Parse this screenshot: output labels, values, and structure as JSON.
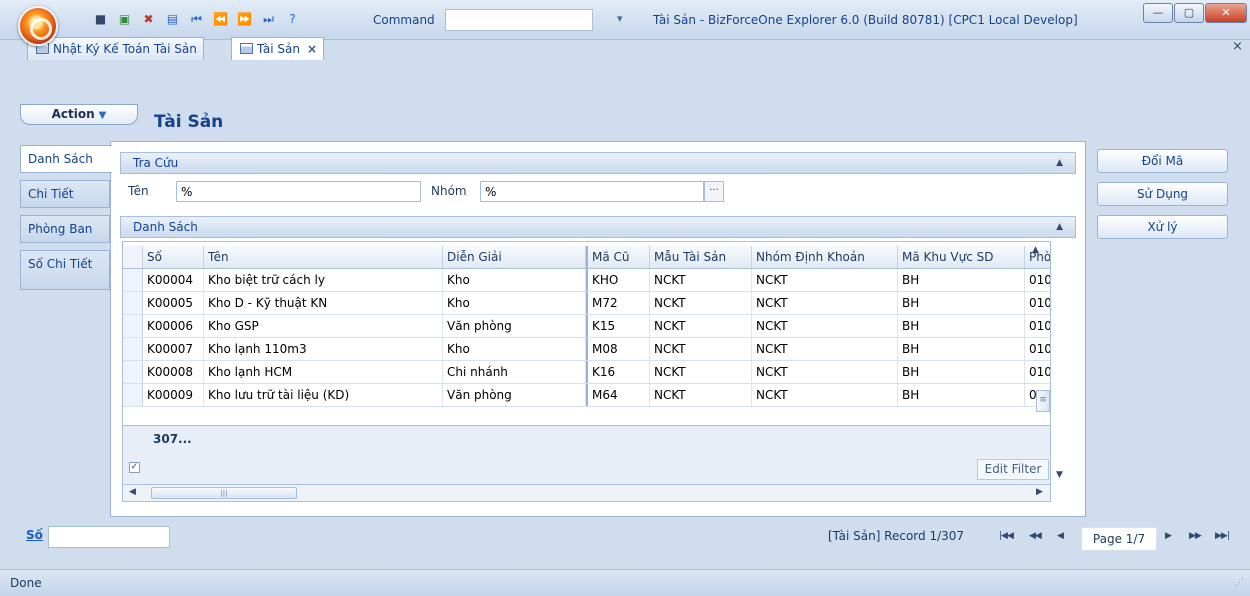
{
  "titlebar": {
    "command_label": "Command",
    "command_value": "",
    "window_title": "Tài Sản - BizForceOne Explorer 6.0 (Build 80781) [CPC1 Local Develop]",
    "qat_more_icon": "dropdown-arrow-icon"
  },
  "tabs": [
    {
      "label": "Nhật Ký Kế Toán Tài Sản"
    },
    {
      "label": "Tài Sản",
      "close": "×"
    }
  ],
  "doc_close_all": "×",
  "toolbar": {
    "action_label": "Action"
  },
  "page_title": "Tài Sản",
  "side_tabs": [
    {
      "label": "Danh Sách"
    },
    {
      "label": "Chi Tiết"
    },
    {
      "label": "Phòng Ban"
    },
    {
      "label": "Số Chi Tiết"
    }
  ],
  "lookup": {
    "header": "Tra Cứu",
    "ten_label": "Tên",
    "ten_value": "%",
    "nhom_label": "Nhóm",
    "nhom_value": "%",
    "lookup_button": "···"
  },
  "list": {
    "header": "Danh Sách",
    "columns": [
      "Số",
      "Tên",
      "Diễn Giải",
      "Mã Cũ",
      "Mẫu Tài Sản",
      "Nhóm Định Khoản",
      "Mã Khu Vực SD",
      "Phò"
    ],
    "rows": [
      [
        "K00004",
        "Kho biệt trữ cách ly",
        "Kho",
        "KHO",
        "NCKT",
        "NCKT",
        "BH",
        "010"
      ],
      [
        "K00005",
        "Kho D - Kỹ thuật KN",
        "Kho",
        "M72",
        "NCKT",
        "NCKT",
        "BH",
        "010"
      ],
      [
        "K00006",
        "Kho GSP",
        "Văn phòng",
        "K15",
        "NCKT",
        "NCKT",
        "BH",
        "010"
      ],
      [
        "K00007",
        "Kho lạnh 110m3",
        "Kho",
        "M08",
        "NCKT",
        "NCKT",
        "BH",
        "010"
      ],
      [
        "K00008",
        "Kho lạnh HCM",
        "Chi nhánh",
        "K16",
        "NCKT",
        "NCKT",
        "BH",
        "010"
      ],
      [
        "K00009",
        "Kho lưu trữ tài liệu (KD)",
        "Văn phòng",
        "M64",
        "NCKT",
        "NCKT",
        "BH",
        "010"
      ]
    ],
    "footer_count": "307...",
    "filter_checked": "✓",
    "edit_filter": "Edit Filter"
  },
  "side_buttons": [
    {
      "label": "Đổi Mã"
    },
    {
      "label": "Sử Dụng"
    },
    {
      "label": "Xử lý"
    }
  ],
  "nav": {
    "so_label": "Số",
    "so_value": "",
    "record_text": "[Tài Sản] Record 1/307",
    "page": "Page 1/7"
  },
  "status": {
    "text": "Done"
  },
  "colors": {
    "accent": "#15428b",
    "panel": "#cfddee",
    "orb": "#e5641a"
  }
}
